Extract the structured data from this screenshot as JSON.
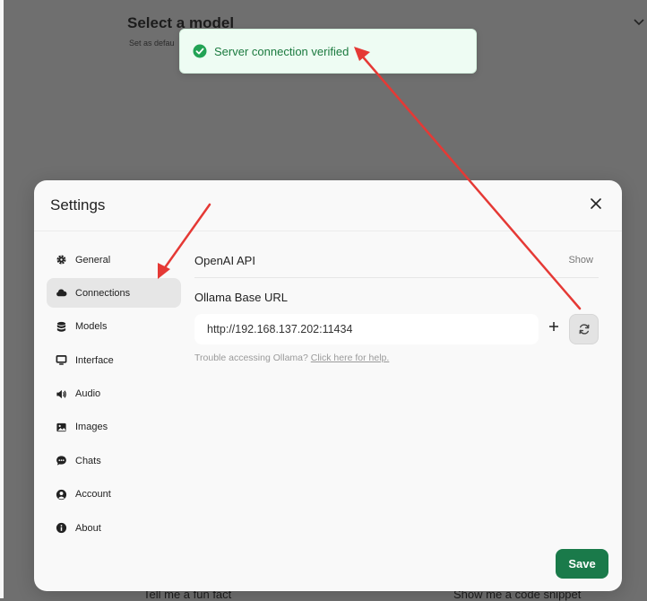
{
  "background": {
    "title": "Select a model",
    "subtitle": "Set as defau",
    "bottom_left": "Tell me a fun fact",
    "bottom_right": "Show me a code snippet"
  },
  "toast": {
    "message": "Server connection verified",
    "icon": "check-circle-icon",
    "color": "#1b7a3f"
  },
  "settings": {
    "title": "Settings",
    "nav": [
      {
        "label": "General",
        "icon": "gear-icon"
      },
      {
        "label": "Connections",
        "icon": "cloud-icon",
        "active": true
      },
      {
        "label": "Models",
        "icon": "database-icon"
      },
      {
        "label": "Interface",
        "icon": "monitor-icon"
      },
      {
        "label": "Audio",
        "icon": "speaker-icon"
      },
      {
        "label": "Images",
        "icon": "image-icon"
      },
      {
        "label": "Chats",
        "icon": "chat-icon"
      },
      {
        "label": "Account",
        "icon": "user-icon"
      },
      {
        "label": "About",
        "icon": "info-icon"
      }
    ],
    "openai_label": "OpenAI API",
    "show_label": "Show",
    "ollama_label": "Ollama Base URL",
    "ollama_url": "http://192.168.137.202:11434",
    "help_text": "Trouble accessing Ollama?",
    "help_link": "Click here for help.",
    "save_label": "Save",
    "accent": "#1a7a4a"
  }
}
